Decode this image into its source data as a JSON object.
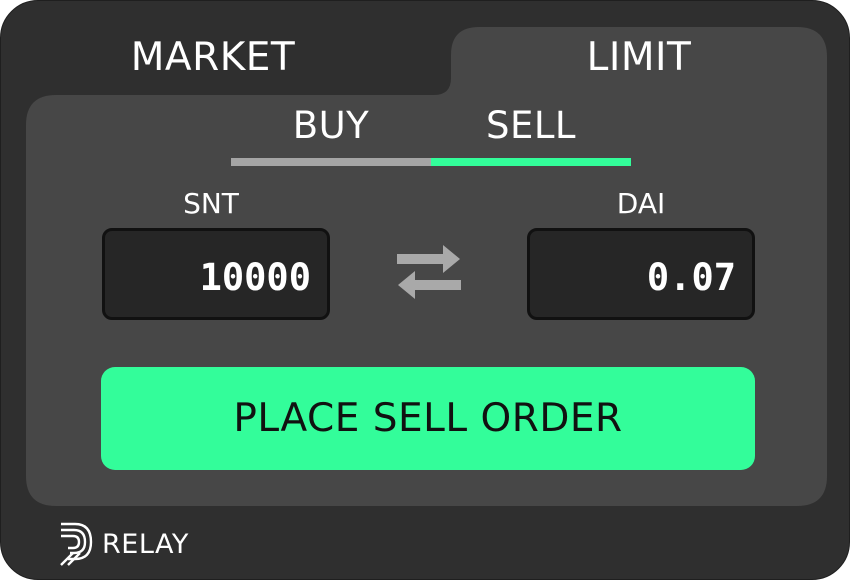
{
  "tabs": {
    "market_label": "MARKET",
    "limit_label": "LIMIT",
    "active": "LIMIT"
  },
  "order_side": {
    "buy_label": "BUY",
    "sell_label": "SELL",
    "active": "SELL"
  },
  "from_token": {
    "symbol": "SNT",
    "amount": "10000"
  },
  "to_token": {
    "symbol": "DAI",
    "amount": "0.07"
  },
  "actions": {
    "place_order_label": "PLACE SELL ORDER"
  },
  "brand": {
    "name": "RELAY"
  },
  "colors": {
    "background": "#2f2f2f",
    "panel": "#474747",
    "accent": "#33fd9a",
    "inactive_bar": "#a5a5a5",
    "field_background": "#262626",
    "icon_grey": "#a9a9a9"
  }
}
